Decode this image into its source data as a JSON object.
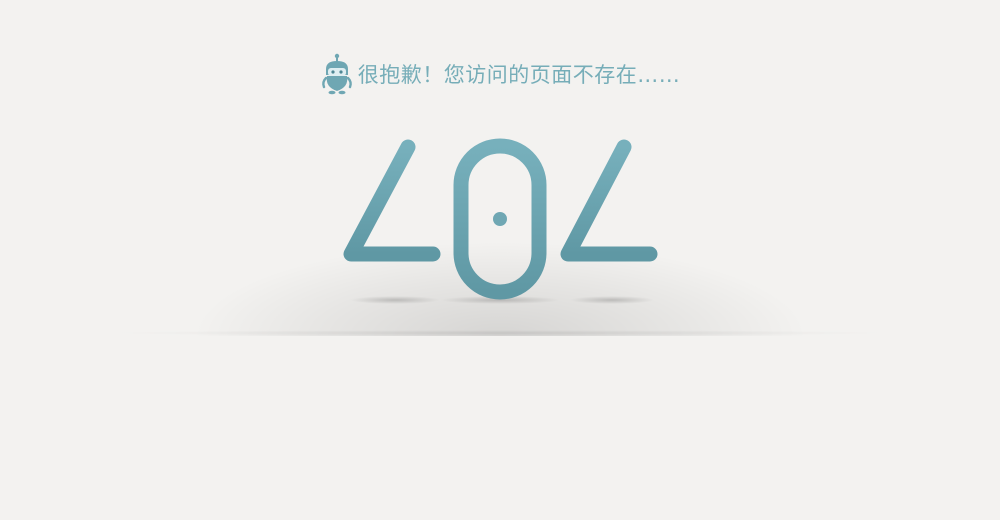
{
  "error": {
    "message": "很抱歉！您访问的页面不存在……",
    "code": "404",
    "icon": "robot-icon",
    "accent_color": "#6fa7b3"
  }
}
